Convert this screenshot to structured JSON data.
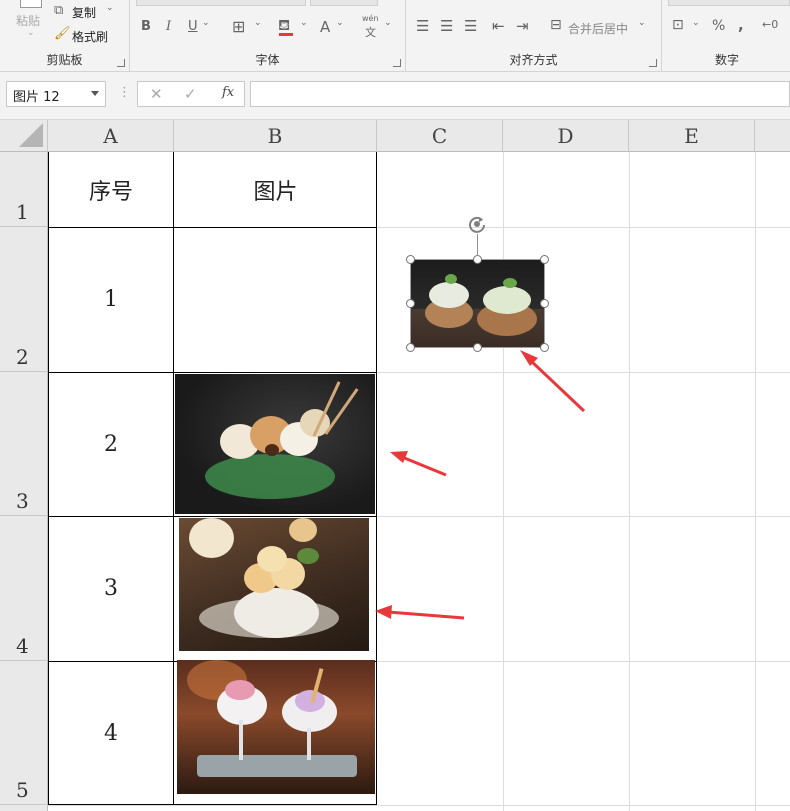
{
  "ribbon": {
    "paste_label": "粘贴",
    "copy_label": "复制",
    "format_painter_label": "格式刷",
    "clipboard_group": "剪贴板",
    "font_group": "字体",
    "bold": "B",
    "italic": "I",
    "underline": "U",
    "font_color": "A",
    "wen_label": "wén",
    "wen_char": "文",
    "align_group": "对齐方式",
    "merge_center_label": "合并后居中",
    "number_group": "数字",
    "percent": "%",
    "comma": ",",
    "decimal": "←0"
  },
  "formula_bar": {
    "name_box": "图片 12",
    "fx_label": "fx",
    "cancel_icon": "✕",
    "enter_icon": "✓",
    "formula_value": ""
  },
  "columns": [
    "A",
    "B",
    "C",
    "D",
    "E"
  ],
  "rows": [
    "1",
    "2",
    "3",
    "4",
    "5"
  ],
  "table": {
    "header_seq": "序号",
    "header_pic": "图片",
    "seq_values": [
      "1",
      "2",
      "3",
      "4"
    ]
  },
  "pictures": [
    {
      "name": "ice-cream-bowls-picture",
      "selected": true
    },
    {
      "name": "ice-cream-sundae-picture",
      "selected": false
    },
    {
      "name": "ice-cream-scoops-picture",
      "selected": false
    },
    {
      "name": "ice-cream-glasses-picture",
      "selected": false
    }
  ],
  "colors": {
    "arrow": "#e8383b",
    "ribbon_bg": "#f3f3f3",
    "header_bg": "#e9e9e9",
    "table_border": "#000000"
  }
}
